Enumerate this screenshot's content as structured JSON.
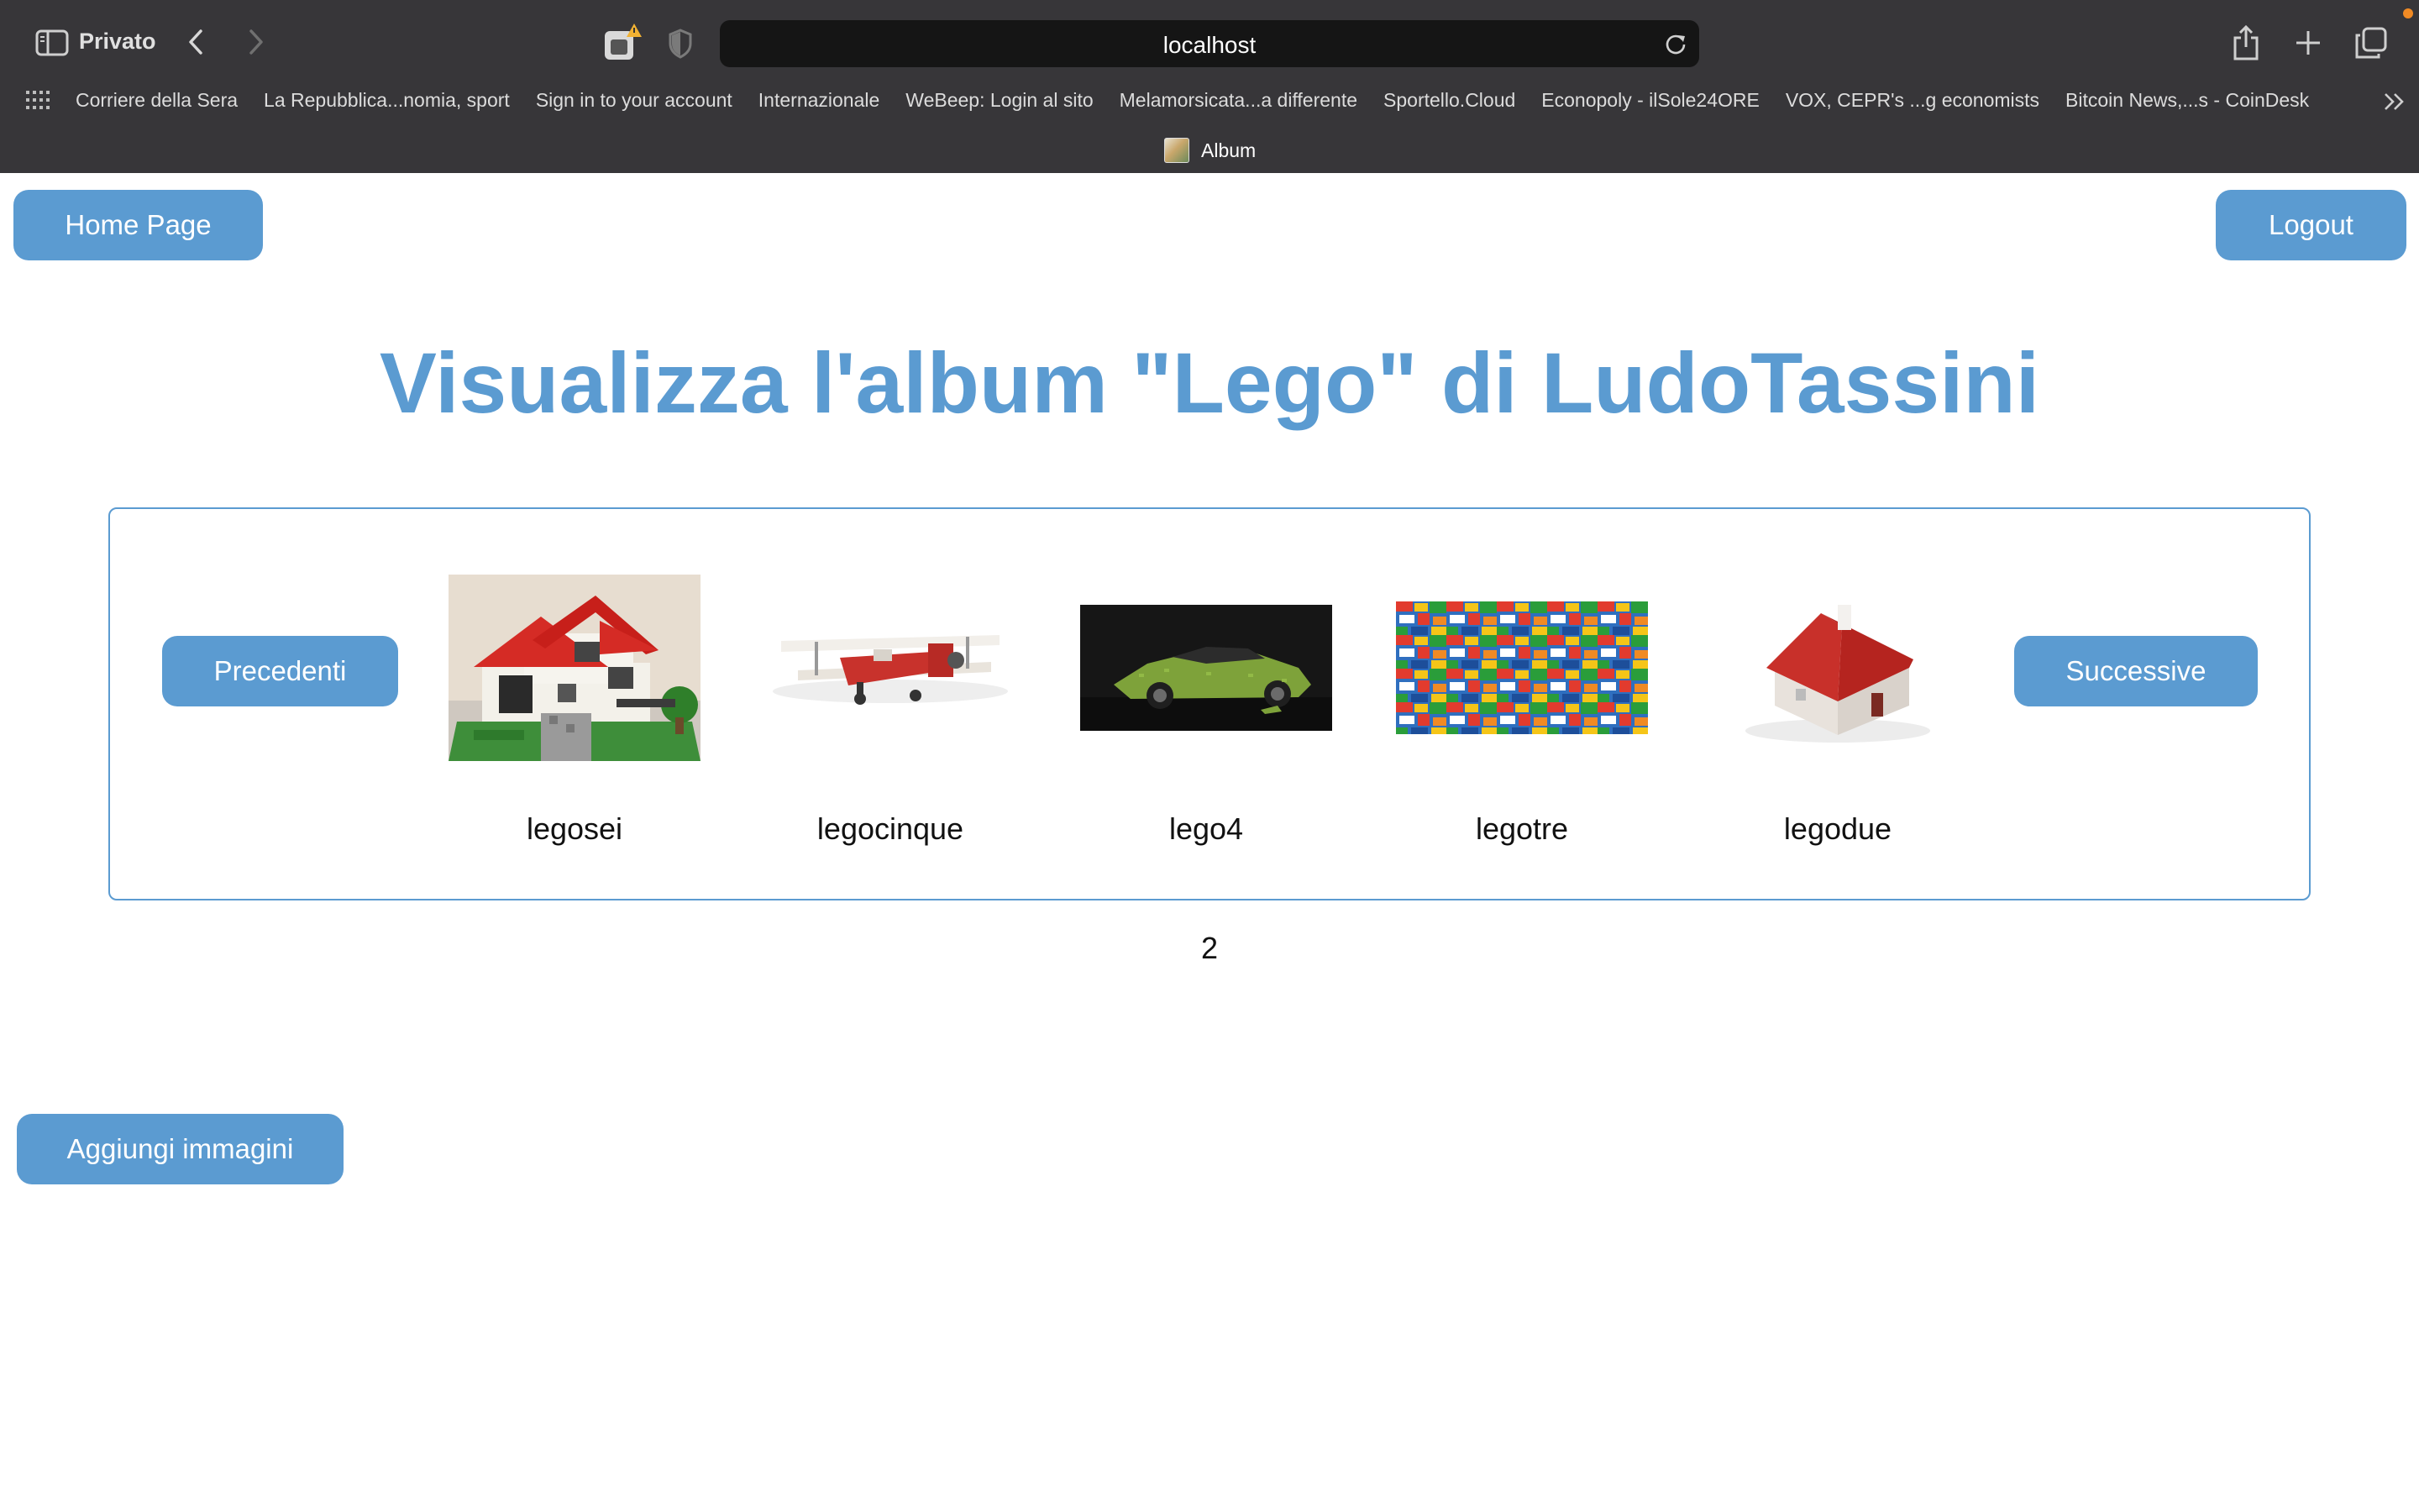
{
  "browser": {
    "private_label": "Privato",
    "address": "localhost",
    "bookmarks": [
      "Corriere della Sera",
      "La Repubblica...nomia, sport",
      "Sign in to your account",
      "Internazionale",
      "WeBeep: Login al sito",
      "Melamorsicata...a differente",
      "Sportello.Cloud",
      "Econopoly - ilSole24ORE",
      "VOX, CEPR's ...g economists",
      "Bitcoin News,...s - CoinDesk"
    ],
    "tab_title": "Album",
    "icons": [
      "sidebar-icon",
      "back-icon",
      "forward-icon",
      "extension-icon",
      "shield-icon",
      "reload-icon",
      "share-icon",
      "new-tab-icon",
      "tab-overview-icon",
      "favorites-grid-icon",
      "more-bookmarks-icon"
    ]
  },
  "page": {
    "home_label": "Home Page",
    "logout_label": "Logout",
    "title": "Visualizza l'album \"Lego\" di LudoTassini",
    "prev_label": "Precedenti",
    "next_label": "Successive",
    "images": [
      {
        "title": "legosei"
      },
      {
        "title": "legocinque"
      },
      {
        "title": "lego4"
      },
      {
        "title": "legotre"
      },
      {
        "title": "legodue"
      }
    ],
    "page_number": "2",
    "add_label": "Aggiungi immagini"
  },
  "colors": {
    "accent": "#5b9bd1",
    "chrome": "#373639",
    "address_bar": "#151515"
  }
}
